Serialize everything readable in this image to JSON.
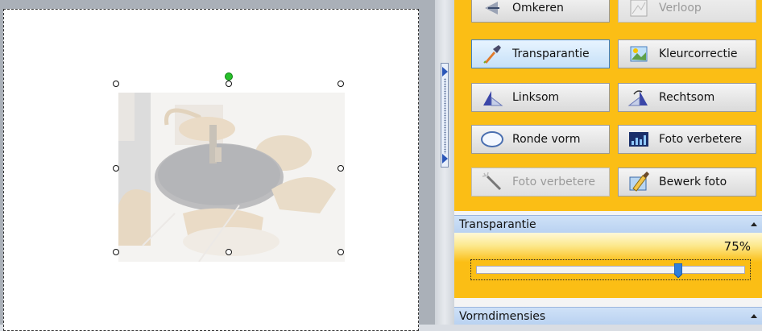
{
  "tools": [
    {
      "id": "omkeren",
      "label": "Omkeren",
      "icon": "flip-icon",
      "state": "normal"
    },
    {
      "id": "verloop",
      "label": "Verloop",
      "icon": "gradient-icon",
      "state": "disabled"
    },
    {
      "id": "transparantie",
      "label": "Transparantie",
      "icon": "eyedropper-icon",
      "state": "active"
    },
    {
      "id": "kleurcorrectie",
      "label": "Kleurcorrectie",
      "icon": "color-correction-icon",
      "state": "normal"
    },
    {
      "id": "linksom",
      "label": "Linksom",
      "icon": "rotate-left-icon",
      "state": "normal"
    },
    {
      "id": "rechtsom",
      "label": "Rechtsom",
      "icon": "rotate-right-icon",
      "state": "normal"
    },
    {
      "id": "ronde-vorm",
      "label": "Ronde vorm",
      "icon": "oval-shape-icon",
      "state": "normal"
    },
    {
      "id": "foto-verbeteren",
      "label": "Foto verbetere",
      "icon": "histogram-icon",
      "state": "normal"
    },
    {
      "id": "foto-verbeteren-auto",
      "label": "Foto verbetere",
      "icon": "magic-wand-icon",
      "state": "disabled"
    },
    {
      "id": "bewerk-foto",
      "label": "Bewerk foto",
      "icon": "brush-icon",
      "state": "normal"
    }
  ],
  "transparency": {
    "title": "Transparantie",
    "value_label": "75%",
    "value": 0.75
  },
  "dimensions": {
    "title": "Vormdimensies"
  },
  "colors": {
    "panel": "#fbbe15",
    "selection_handle": "#ffffff",
    "rotate_handle": "#27c02b",
    "active_button": "#c6e0f7"
  }
}
